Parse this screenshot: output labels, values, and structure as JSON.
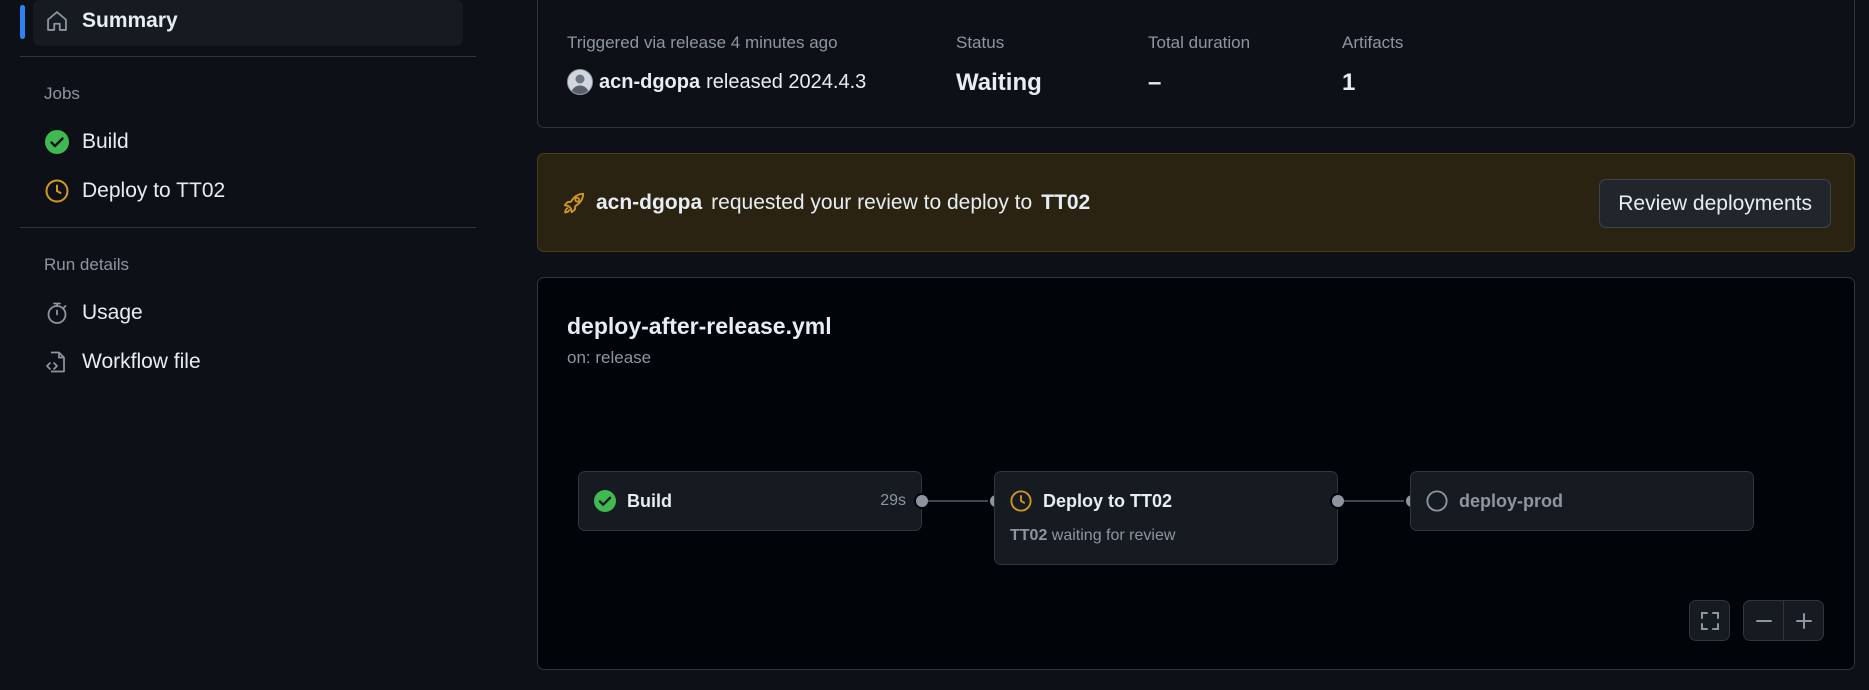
{
  "sidebar": {
    "summary_label": "Summary",
    "jobs_heading": "Jobs",
    "jobs": [
      {
        "label": "Build",
        "status": "success"
      },
      {
        "label": "Deploy to TT02",
        "status": "waiting"
      }
    ],
    "run_details_heading": "Run details",
    "run_details": [
      {
        "label": "Usage",
        "icon": "stopwatch-icon"
      },
      {
        "label": "Workflow file",
        "icon": "file-code-icon"
      }
    ]
  },
  "run_info": {
    "trigger_text": "Triggered via release 4 minutes ago",
    "actor": "acn-dgopa",
    "action_text": "released 2024.4.3",
    "status_label": "Status",
    "status_value": "Waiting",
    "duration_label": "Total duration",
    "duration_value": "–",
    "artifacts_label": "Artifacts",
    "artifacts_value": "1"
  },
  "review": {
    "actor": "acn-dgopa",
    "text": "requested your review to deploy to",
    "environment": "TT02",
    "button_label": "Review deployments"
  },
  "workflow": {
    "filename": "deploy-after-release.yml",
    "trigger": "on: release",
    "jobs": [
      {
        "name": "Build",
        "status": "success",
        "duration": "29s"
      },
      {
        "name": "Deploy to TT02",
        "status": "waiting",
        "env": "TT02",
        "sub_text": "waiting for review"
      },
      {
        "name": "deploy-prod",
        "status": "pending"
      }
    ]
  },
  "colors": {
    "accent": "#2f81f7",
    "success": "#3fb950",
    "waiting": "#d29922",
    "banner_bg": "#2b2311"
  }
}
